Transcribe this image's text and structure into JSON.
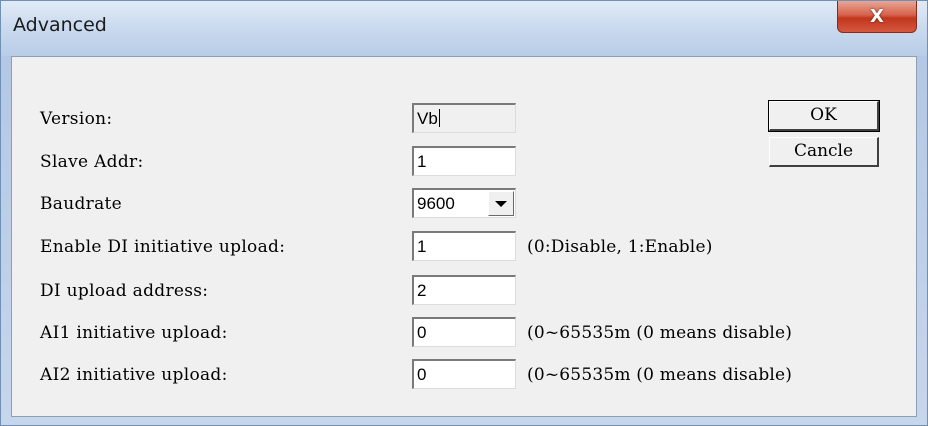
{
  "window": {
    "title": "Advanced",
    "close_glyph": "X"
  },
  "form": {
    "version": {
      "label": "Version:",
      "value": "Vb"
    },
    "slave_addr": {
      "label": "Slave Addr:",
      "value": "1"
    },
    "baudrate": {
      "label": "Baudrate",
      "selected": "9600"
    },
    "enable_di": {
      "label": "Enable DI initiative upload:",
      "value": "1",
      "hint": "(0:Disable, 1:Enable)"
    },
    "di_address": {
      "label": "DI upload address:",
      "value": "2"
    },
    "ai1": {
      "label": "AI1 initiative upload:",
      "value": "0",
      "hint": "(0~65535m (0 means disable)"
    },
    "ai2": {
      "label": "AI2 initiative upload:",
      "value": "0",
      "hint": "(0~65535m (0 means disable)"
    }
  },
  "buttons": {
    "ok": "OK",
    "cancel": "Cancle"
  },
  "icons": {
    "close": "close-icon",
    "dropdown": "chevron-down-icon"
  },
  "colors": {
    "close_button": "#c9412a",
    "dialog_background": "#f0f0f0",
    "frame": "#b9cde9"
  }
}
